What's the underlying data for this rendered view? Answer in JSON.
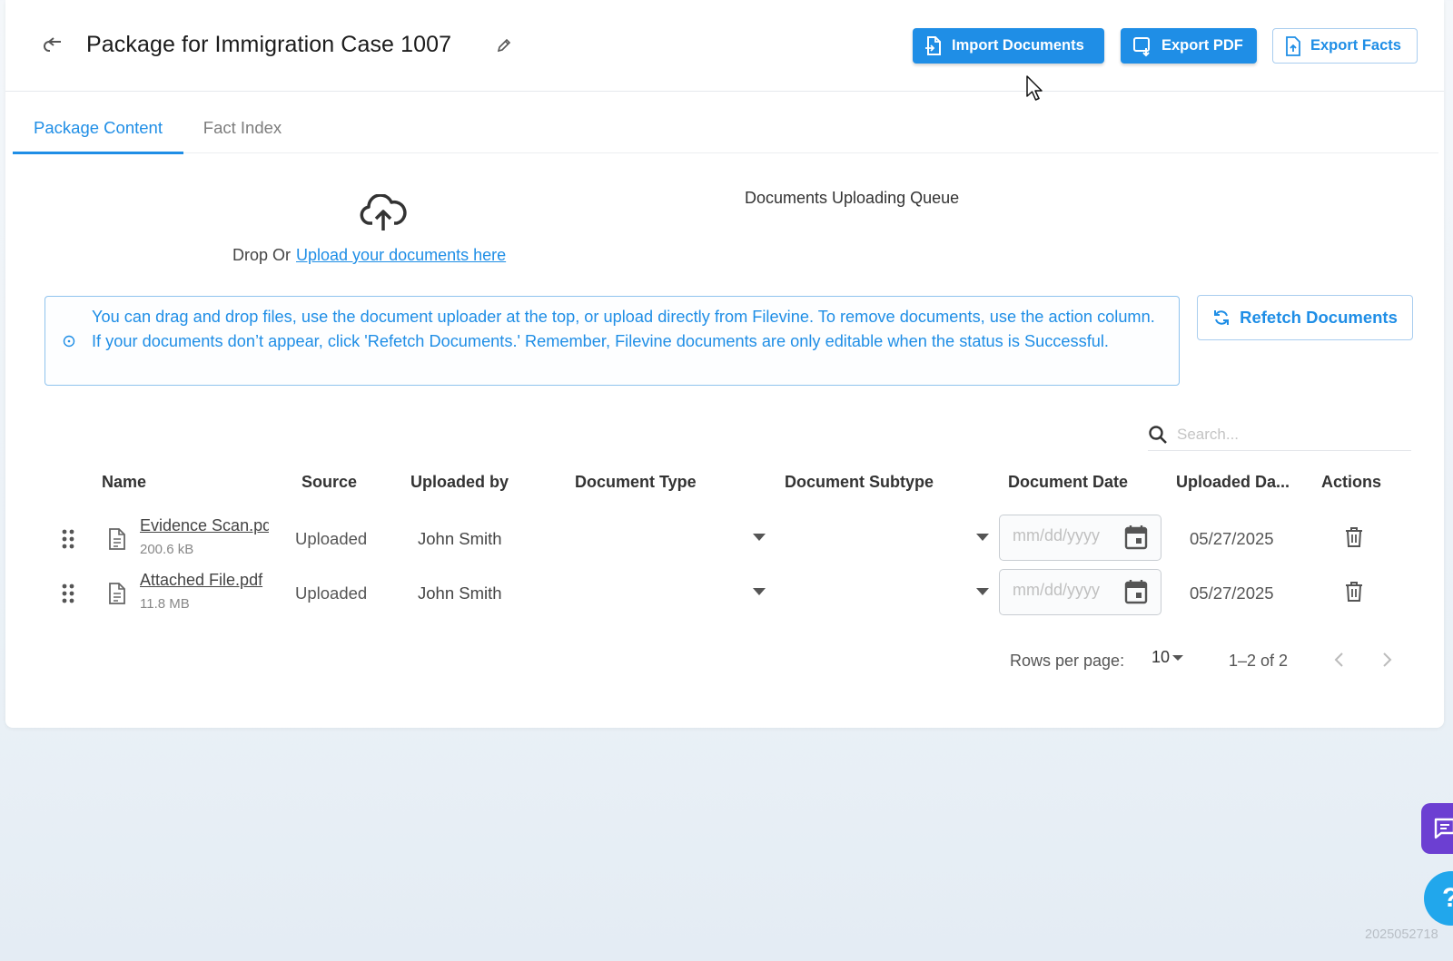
{
  "header": {
    "title": "Package for Immigration Case 1007",
    "buttons": {
      "import": "Import Documents",
      "export_pdf": "Export PDF",
      "export_facts": "Export Facts"
    }
  },
  "tabs": [
    {
      "label": "Package Content",
      "active": true
    },
    {
      "label": "Fact Index",
      "active": false
    }
  ],
  "upload": {
    "drop_prefix": "Drop Or",
    "upload_link": "Upload your documents here",
    "queue_title": "Documents Uploading Queue"
  },
  "info": {
    "text": "You can drag and drop files, use the document uploader at the top, or upload directly from Filevine. To remove documents, use the action column. If your documents don’t appear, click 'Refetch Documents.' Remember, Filevine documents are only editable when the status is Successful."
  },
  "refetch_label": "Refetch Documents",
  "search": {
    "placeholder": "Search..."
  },
  "table": {
    "columns": [
      "Name",
      "Source",
      "Uploaded by",
      "Document Type",
      "Document Subtype",
      "Document Date",
      "Uploaded Da...",
      "Actions"
    ],
    "rows": [
      {
        "name": "Evidence Scan.pdf",
        "size": "200.6 kB",
        "source": "Uploaded",
        "uploaded_by": "John Smith",
        "document_type": "",
        "document_subtype": "",
        "date_placeholder": "mm/dd/yyyy",
        "uploaded_date": "05/27/2025"
      },
      {
        "name": "Attached File.pdf",
        "size": "11.8 MB",
        "source": "Uploaded",
        "uploaded_by": "John Smith",
        "document_type": "",
        "document_subtype": "",
        "date_placeholder": "mm/dd/yyyy",
        "uploaded_date": "05/27/2025"
      }
    ]
  },
  "pagination": {
    "rows_per_page_label": "Rows per page:",
    "rows_per_page": "10",
    "range": "1–2 of 2"
  },
  "version": "2025052718",
  "colors": {
    "primary": "#1f8ee6",
    "chat": "#6c3fd2",
    "help": "#21a7ec"
  }
}
